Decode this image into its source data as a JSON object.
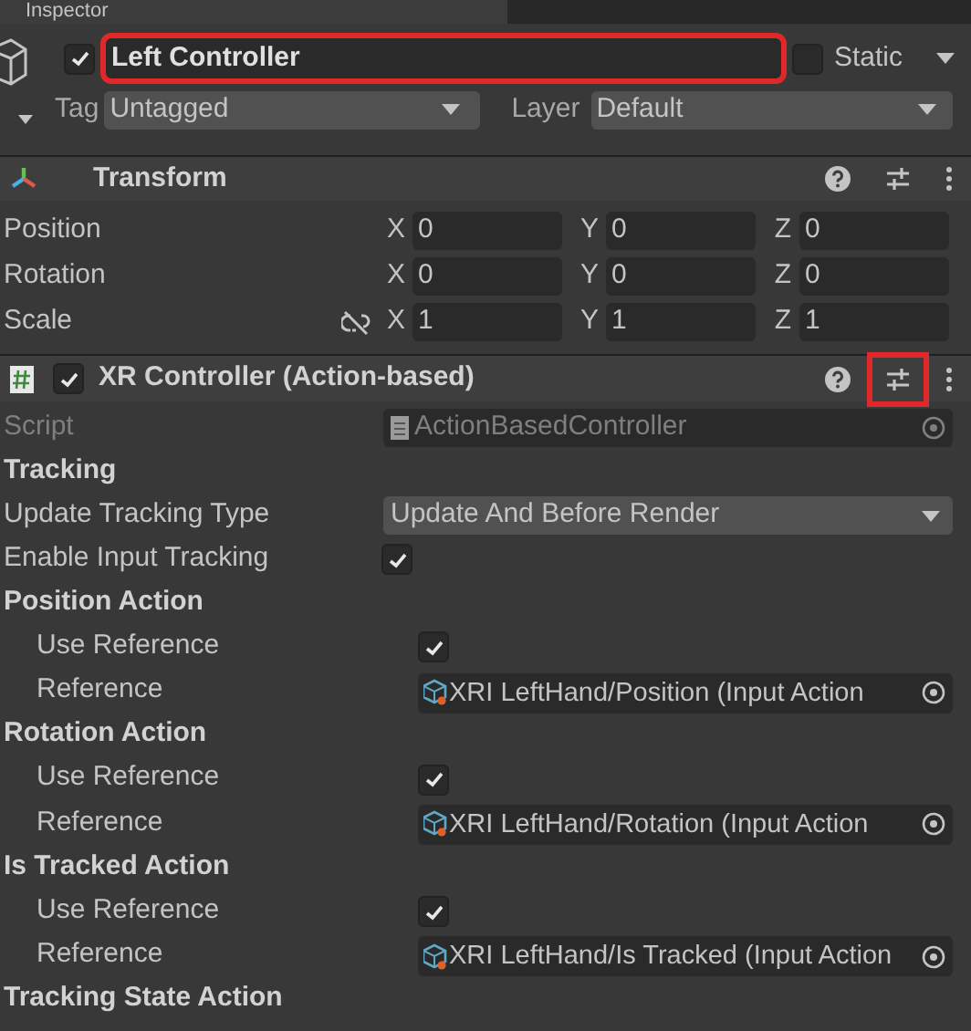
{
  "inspector_tab": "Inspector",
  "game_object": {
    "active": true,
    "name": "Left Controller",
    "name_highlighted": true,
    "static": false,
    "static_label": "Static",
    "tag_label": "Tag",
    "tag": "Untagged",
    "layer_label": "Layer",
    "layer": "Default"
  },
  "components": [
    {
      "kind": "transform",
      "title": "Transform",
      "presets_highlighted": false,
      "rows": [
        {
          "label": "Position",
          "link_icon": false,
          "axes": [
            {
              "axis": "X",
              "value": "0"
            },
            {
              "axis": "Y",
              "value": "0"
            },
            {
              "axis": "Z",
              "value": "0"
            }
          ]
        },
        {
          "label": "Rotation",
          "link_icon": false,
          "axes": [
            {
              "axis": "X",
              "value": "0"
            },
            {
              "axis": "Y",
              "value": "0"
            },
            {
              "axis": "Z",
              "value": "0"
            }
          ]
        },
        {
          "label": "Scale",
          "link_icon": true,
          "axes": [
            {
              "axis": "X",
              "value": "1"
            },
            {
              "axis": "Y",
              "value": "1"
            },
            {
              "axis": "Z",
              "value": "1"
            }
          ]
        }
      ]
    },
    {
      "kind": "script",
      "title": "XR Controller (Action-based)",
      "enabled": true,
      "presets_highlighted": true,
      "rows": [
        {
          "kind": "object",
          "label": "Script",
          "value": "ActionBasedController",
          "disabled": true
        },
        {
          "kind": "header",
          "label": "Tracking"
        },
        {
          "kind": "dropdown",
          "label": "Update Tracking Type",
          "value": "Update And Before Render"
        },
        {
          "kind": "checkbox",
          "label": "Enable Input Tracking",
          "checked": true
        },
        {
          "kind": "group",
          "label": "Position Action",
          "children": [
            {
              "kind": "checkbox",
              "label": "Use Reference",
              "checked": true
            },
            {
              "kind": "reference",
              "label": "Reference",
              "value": "XRI LeftHand/Position (Input Action"
            }
          ]
        },
        {
          "kind": "group",
          "label": "Rotation Action",
          "children": [
            {
              "kind": "checkbox",
              "label": "Use Reference",
              "checked": true
            },
            {
              "kind": "reference",
              "label": "Reference",
              "value": "XRI LeftHand/Rotation (Input Action"
            }
          ]
        },
        {
          "kind": "group",
          "label": "Is Tracked Action",
          "children": [
            {
              "kind": "checkbox",
              "label": "Use Reference",
              "checked": true
            },
            {
              "kind": "reference",
              "label": "Reference",
              "value": "XRI LeftHand/Is Tracked (Input Action"
            }
          ]
        },
        {
          "kind": "header",
          "label": "Tracking State Action"
        }
      ]
    }
  ]
}
